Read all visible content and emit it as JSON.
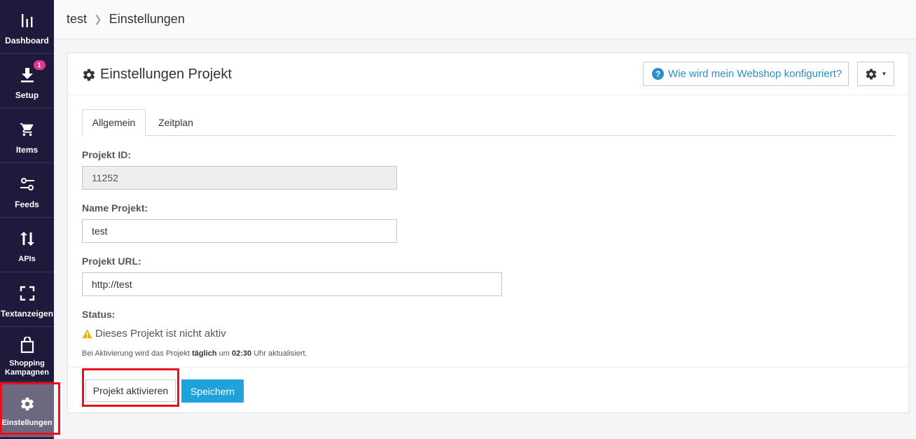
{
  "sidebar": {
    "items": [
      {
        "label": "Dashboard",
        "icon": "bar-chart-icon"
      },
      {
        "label": "Setup",
        "icon": "download-icon",
        "badge": "1"
      },
      {
        "label": "Items",
        "icon": "cart-icon"
      },
      {
        "label": "Feeds",
        "icon": "sliders-icon"
      },
      {
        "label": "APIs",
        "icon": "arrows-up-down-icon"
      },
      {
        "label": "Textanzeigen",
        "icon": "frame-corners-icon"
      },
      {
        "label": "Shopping Kampagnen",
        "icon": "shopping-bag-icon"
      },
      {
        "label": "Einstellungen",
        "icon": "gear-icon"
      }
    ],
    "active_index": 7
  },
  "breadcrumb": {
    "project": "test",
    "page": "Einstellungen"
  },
  "card": {
    "title": "Einstellungen Projekt",
    "help_label": "Wie wird mein Webshop konfiguriert?"
  },
  "tabs": [
    {
      "label": "Allgemein",
      "active": true
    },
    {
      "label": "Zeitplan",
      "active": false
    }
  ],
  "form": {
    "project_id_label": "Projekt ID:",
    "project_id_value": "11252",
    "name_label": "Name Projekt:",
    "name_value": "test",
    "url_label": "Projekt URL:",
    "url_value": "http://test",
    "status_label": "Status:",
    "status_text": "Dieses Projekt ist nicht aktiv",
    "hint_prefix": "Bei Aktivierung wird das Projekt",
    "hint_bold1": "täglich",
    "hint_mid": "um",
    "hint_bold2": "02:30",
    "hint_suffix": "Uhr aktualisiert."
  },
  "footer": {
    "activate_label": "Projekt aktivieren",
    "save_label": "Speichern"
  },
  "colors": {
    "sidebar_bg": "#1e1a3c",
    "accent": "#1ea2dc",
    "link": "#2a8fc8",
    "badge": "#e6358b",
    "warning": "#f0b400",
    "highlight": "#e8101a"
  }
}
